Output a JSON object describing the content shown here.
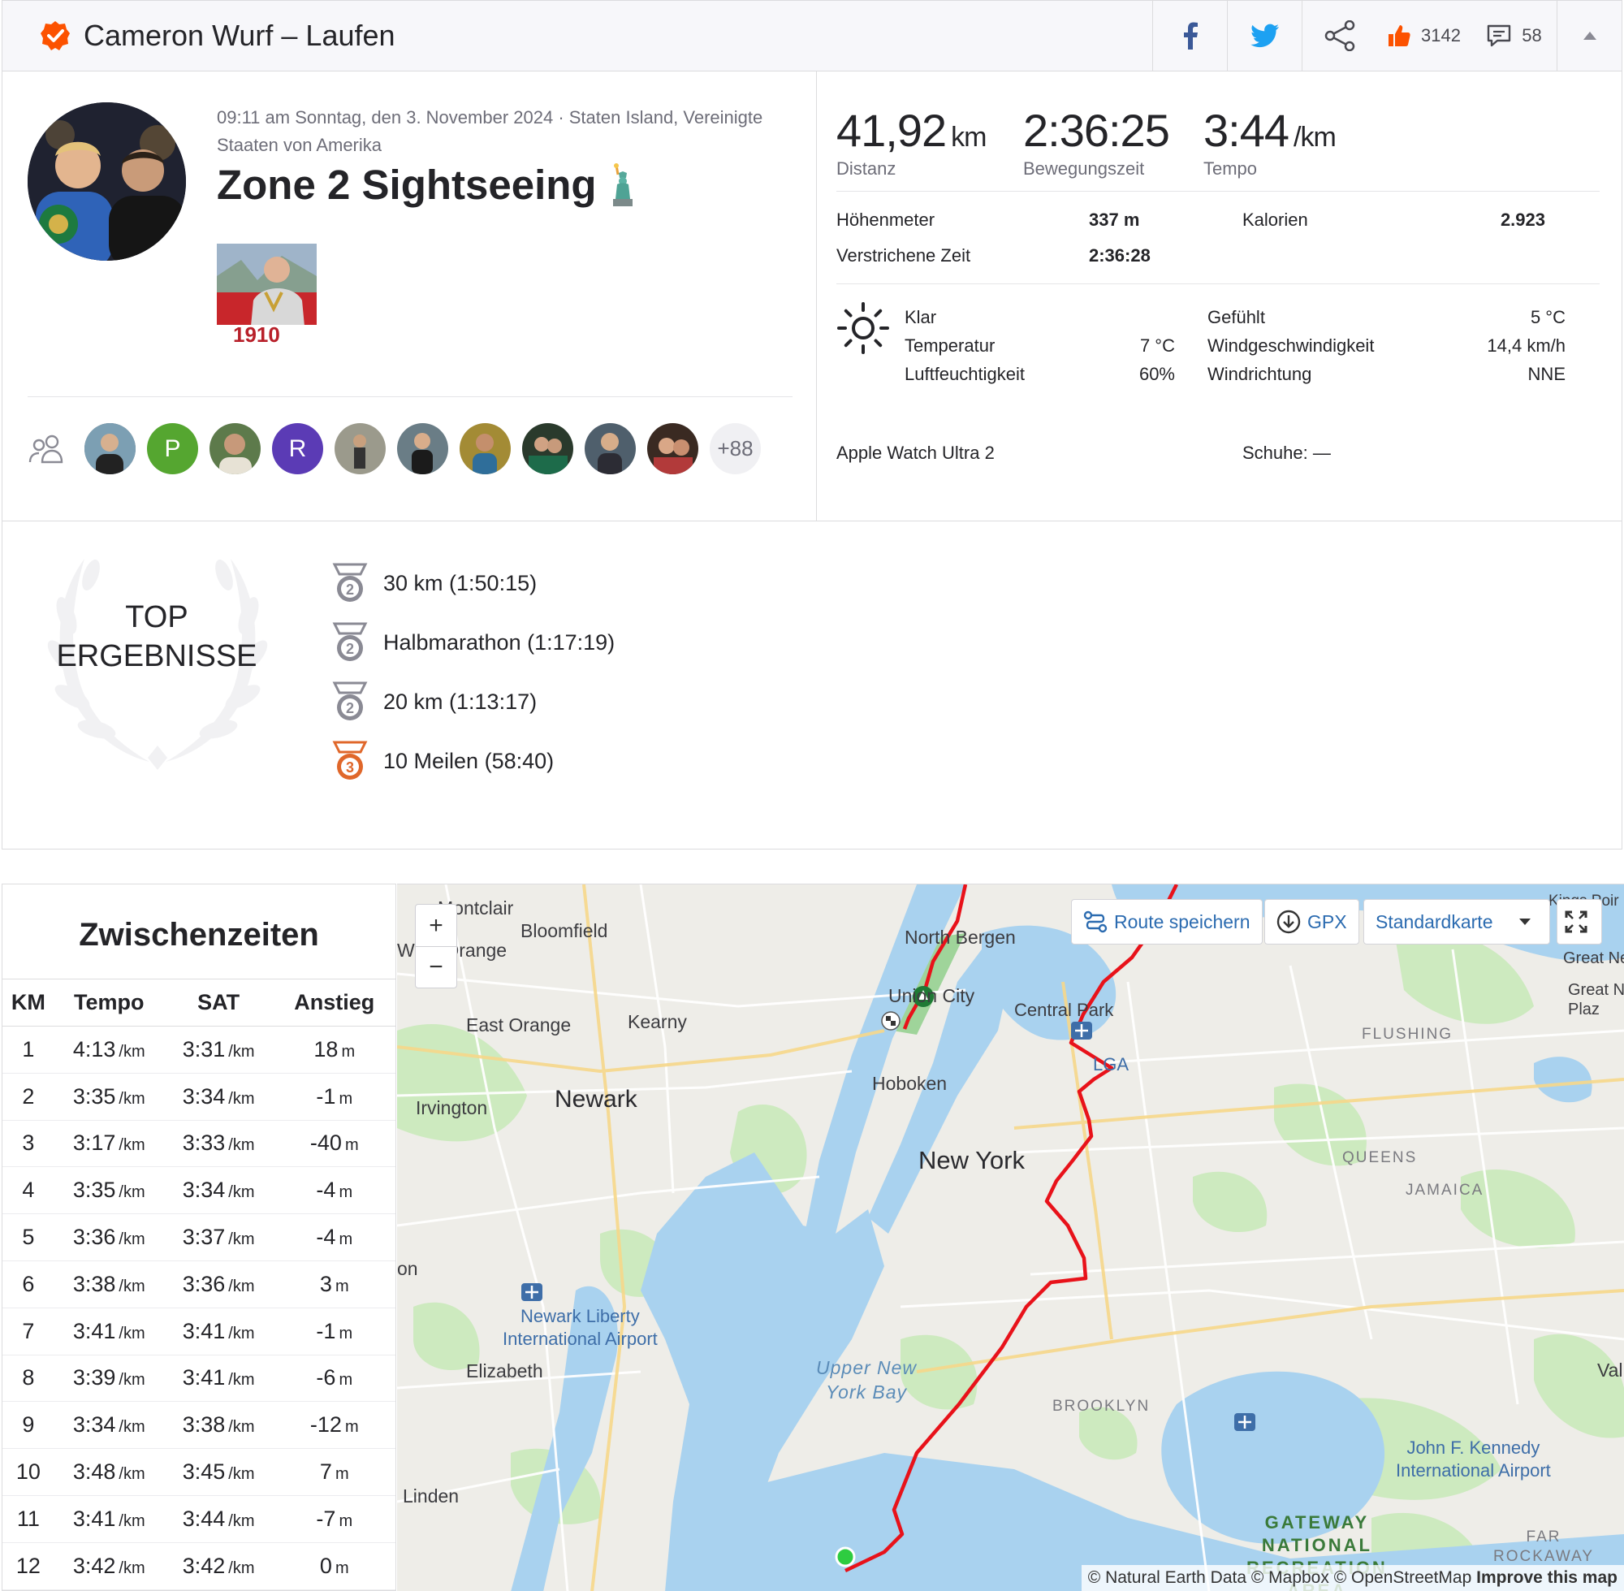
{
  "header": {
    "title": "Cameron Wurf – Laufen",
    "kudos_count": "3142",
    "comment_count": "58"
  },
  "activity": {
    "meta": "09:11 am Sonntag, den 3. November 2024 · Staten Island, Vereinigte Staaten von Amerika",
    "title": "Zone 2 Sightseeing",
    "kudos_more": "+88",
    "kudos_letters": [
      "P",
      "R"
    ]
  },
  "stats": {
    "distance": {
      "value": "41,92",
      "unit": "km",
      "label": "Distanz"
    },
    "moving_time": {
      "value": "2:36:25",
      "label": "Bewegungszeit"
    },
    "pace": {
      "value": "3:44",
      "unit": "/km",
      "label": "Tempo"
    },
    "elevation_label": "Höhenmeter",
    "elevation_value": "337 m",
    "calories_label": "Kalorien",
    "calories_value": "2.923",
    "elapsed_label": "Verstrichene Zeit",
    "elapsed_value": "2:36:28"
  },
  "weather": {
    "condition": "Klar",
    "temp_label": "Temperatur",
    "temp_value": "7 °C",
    "humidity_label": "Luftfeuchtigkeit",
    "humidity_value": "60%",
    "feels_label": "Gefühlt",
    "feels_value": "5 °C",
    "wind_label": "Windgeschwindigkeit",
    "wind_value": "14,4 km/h",
    "dir_label": "Windrichtung",
    "dir_value": "NNE"
  },
  "gear": {
    "device": "Apple Watch Ultra 2",
    "shoes": "Schuhe: —"
  },
  "top_results": {
    "label_line1": "TOP",
    "label_line2": "ERGEBNISSE",
    "items": [
      {
        "rank": "2",
        "text": "30 km  (1:50:15)"
      },
      {
        "rank": "2",
        "text": "Halbmarathon  (1:17:19)"
      },
      {
        "rank": "2",
        "text": "20 km  (1:13:17)"
      },
      {
        "rank": "3",
        "text": "10 Meilen  (58:40)"
      }
    ]
  },
  "splits": {
    "title": "Zwischenzeiten",
    "headers": [
      "KM",
      "Tempo",
      "SAT",
      "Anstieg"
    ],
    "pace_unit": "/km",
    "elev_unit": "m",
    "rows": [
      [
        "1",
        "4:13",
        "3:31",
        "18"
      ],
      [
        "2",
        "3:35",
        "3:34",
        "-1"
      ],
      [
        "3",
        "3:17",
        "3:33",
        "-40"
      ],
      [
        "4",
        "3:35",
        "3:34",
        "-4"
      ],
      [
        "5",
        "3:36",
        "3:37",
        "-4"
      ],
      [
        "6",
        "3:38",
        "3:36",
        "3"
      ],
      [
        "7",
        "3:41",
        "3:41",
        "-1"
      ],
      [
        "8",
        "3:39",
        "3:41",
        "-6"
      ],
      [
        "9",
        "3:34",
        "3:38",
        "-12"
      ],
      [
        "10",
        "3:48",
        "3:45",
        "7"
      ],
      [
        "11",
        "3:41",
        "3:44",
        "-7"
      ],
      [
        "12",
        "3:42",
        "3:42",
        "0"
      ]
    ]
  },
  "map": {
    "zoom_in": "+",
    "zoom_out": "−",
    "save_route": "Route speichern",
    "gpx": "GPX",
    "map_type": "Standardkarte",
    "attribution": "© Natural Earth Data © Mapbox © OpenStreetMap",
    "improve": "Improve this map",
    "labels": {
      "montclair": "Montclair",
      "bloomfield": "Bloomfield",
      "west_orange": "West Orange",
      "north_bergen": "North Bergen",
      "union_city": "Union City",
      "central_park": "Central Park",
      "lga": "LGA",
      "flushing": "FLUSHING",
      "east_orange": "East Orange",
      "kearny": "Kearny",
      "hoboken": "Hoboken",
      "newark": "Newark",
      "irvington": "Irvington",
      "new_york": "New York",
      "queens": "QUEENS",
      "jamaica": "JAMAICA",
      "newark_airport": "Newark Liberty\nInternational Airport",
      "elizabeth": "Elizabeth",
      "upper_bay": "Upper New\nYork Bay",
      "brooklyn": "BROOKLYN",
      "jfk": "John F. Kennedy\nInternational Airport",
      "linden": "Linden",
      "gateway": "GATEWAY\nNATIONAL\nRECREATION\nAREA",
      "far_rockaway": "FAR\nROCKAWAY",
      "great_neck": "Great Ne",
      "great_neck_plaza": "Great N\nPlaz",
      "kings_point": "Kings Poir",
      "vall": "Vall",
      "on": "on"
    }
  },
  "colors": {
    "strava_orange": "#fc5200",
    "route_red": "#e8121a",
    "link_blue": "#2b6bb0",
    "water": "#aad3f0",
    "park": "#bfe5b1"
  }
}
